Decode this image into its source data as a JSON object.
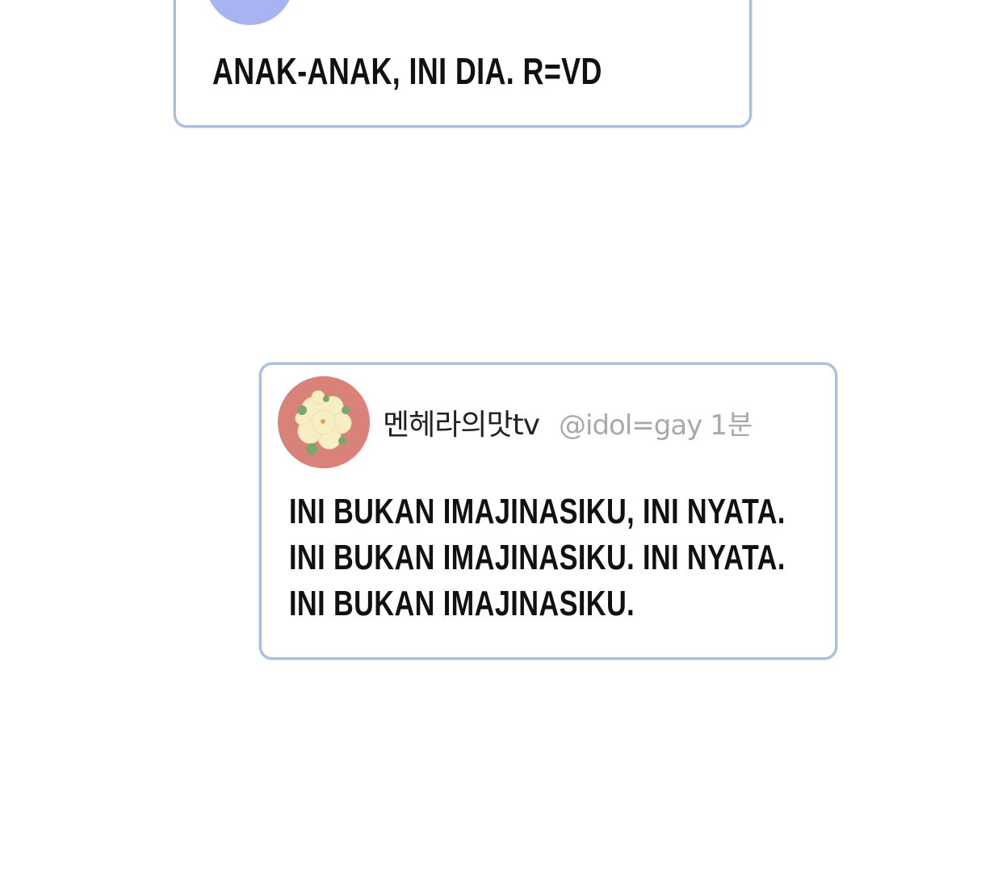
{
  "posts": [
    {
      "display_name": "",
      "handle": "",
      "timestamp": "",
      "avatar_color": "#a8b4f2",
      "lines": [
        "ANAK-ANAK, INI DIA. R=VD"
      ]
    },
    {
      "display_name": "멘헤라의맛tv",
      "handle": "@idol=gay",
      "timestamp": "1분",
      "avatar_color": "#d9827a",
      "avatar_icon": "flower-icon",
      "lines": [
        "INI BUKAN IMAJINASIKU, INI NYATA.",
        "INI BUKAN IMAJINASIKU. INI NYATA.",
        "INI BUKAN IMAJINASIKU."
      ]
    }
  ],
  "colors": {
    "card_border": "#a9bfdc",
    "handle_gray": "#a9a9a9",
    "text": "#111111",
    "background": "#ffffff"
  }
}
